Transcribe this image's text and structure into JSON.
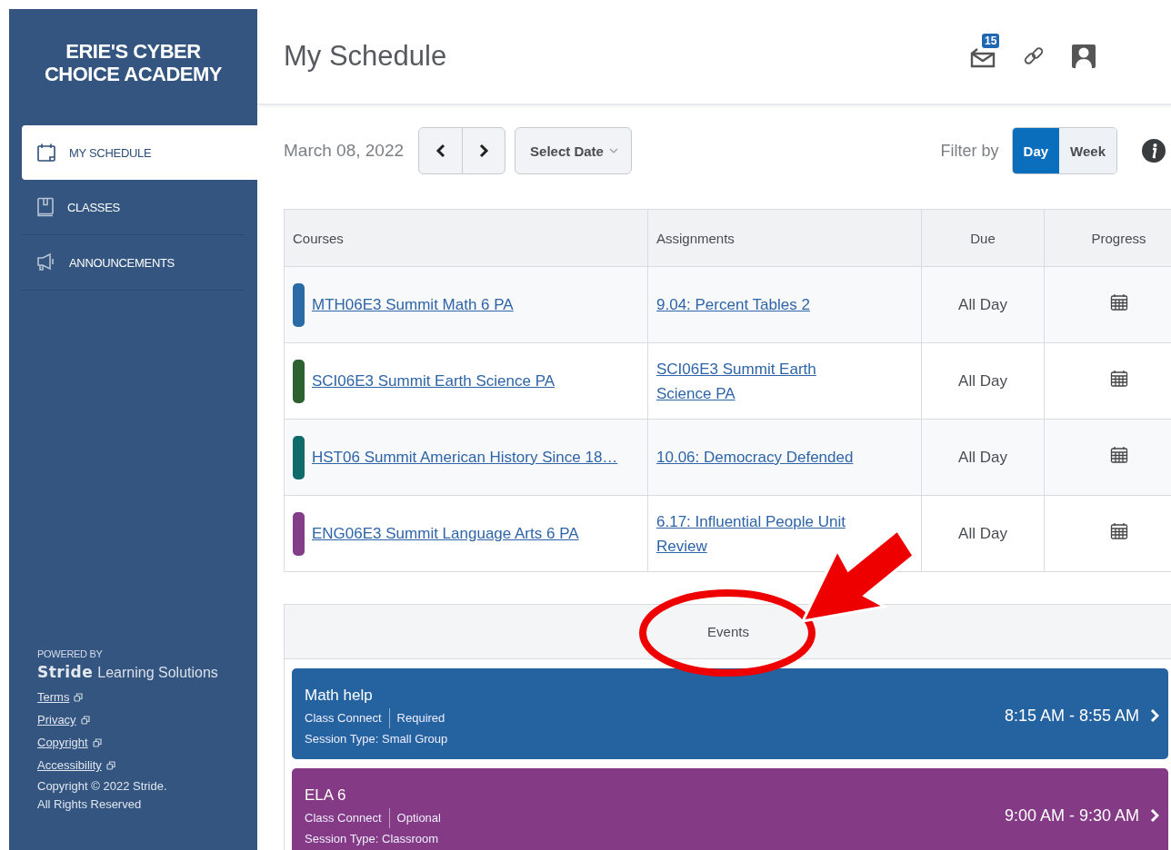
{
  "sidebar": {
    "school_name": "ERIE'S CYBER CHOICE ACADEMY",
    "nav_items": [
      {
        "label": "MY SCHEDULE",
        "kind": "calendar",
        "selected": true
      },
      {
        "label": "CLASSES",
        "kind": "book",
        "selected": false
      },
      {
        "label": "ANNOUNCEMENTS",
        "kind": "megaphone",
        "selected": false
      }
    ],
    "footer": {
      "powered_by": "POWERED BY",
      "brand": "Stride",
      "brand_suffix": "Learning Solutions",
      "links": [
        "Terms",
        "Privacy",
        "Copyright",
        "Accessibility"
      ],
      "copyright": "Copyright © 2022 Stride.",
      "rights": "All Rights Reserved"
    }
  },
  "header": {
    "title": "My Schedule",
    "mail_badge": "15"
  },
  "toolbar": {
    "date": "March 08, 2022",
    "select_date": "Select Date",
    "filter_label": "Filter by",
    "filter_options": [
      {
        "label": "Day",
        "selected": true
      },
      {
        "label": "Week",
        "selected": false
      }
    ]
  },
  "table": {
    "columns": [
      "Courses",
      "Assignments",
      "Due",
      "Progress"
    ],
    "rows": [
      {
        "course": "MTH06E3 Summit Math 6 PA",
        "color": "#2a6aa5",
        "assignment": "9.04: Percent Tables 2",
        "due": "All Day"
      },
      {
        "course": "SCI06E3 Summit Earth Science PA",
        "color": "#2e6130",
        "assignment": "SCI06E3 Summit Earth Science PA",
        "due": "All Day"
      },
      {
        "course": "HST06 Summit American History Since 18…",
        "color": "#0e6b6a",
        "assignment": "10.06: Democracy Defended",
        "due": "All Day"
      },
      {
        "course": "ENG06E3 Summit Language Arts 6 PA",
        "color": "#823f87",
        "assignment": "6.17: Influential People Unit Review",
        "due": "All Day"
      }
    ]
  },
  "events": {
    "title": "Events",
    "items": [
      {
        "title": "Math help",
        "type": "Class Connect",
        "requirement": "Required",
        "session": "Session Type: Small Group",
        "time": "8:15 AM - 8:55 AM",
        "color": "#2563a0"
      },
      {
        "title": "ELA 6",
        "type": "Class Connect",
        "requirement": "Optional",
        "session": "Session Type: Classroom",
        "time": "9:00 AM - 9:30 AM",
        "color": "#843a84"
      }
    ]
  }
}
